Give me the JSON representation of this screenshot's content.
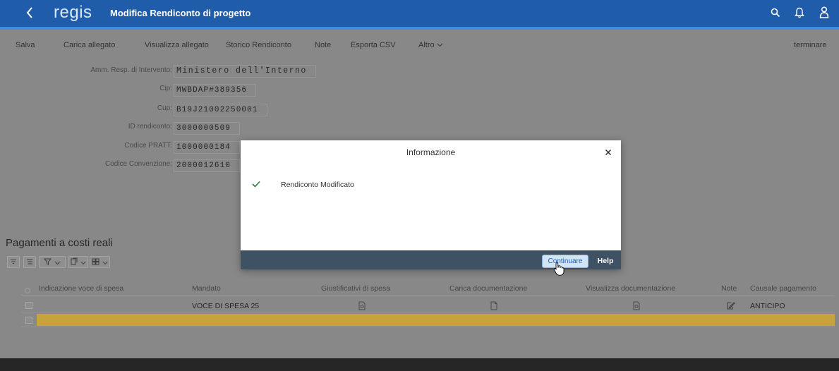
{
  "shell": {
    "logo": "regis",
    "title": "Modifica Rendiconto di progetto"
  },
  "toolbar": {
    "items": [
      "Salva",
      "Carica allegato",
      "Visualizza allegato",
      "Storico Rendiconto",
      "Note",
      "Esporta CSV"
    ],
    "more_label": "Altro",
    "exit_label": "terminare"
  },
  "form": {
    "fields": [
      {
        "label": "Amm. Resp. di Intervento:",
        "value": "Ministero dell'Interno"
      },
      {
        "label": "Cip:",
        "value": "MWBDAP#389356"
      },
      {
        "label": "Cup:",
        "value": "B19J21002250001"
      },
      {
        "label": "ID rendiconto:",
        "value": "3000000509"
      },
      {
        "label": "Codice PRATT:",
        "value": "1000000184"
      },
      {
        "label": "Codice Convenzione:",
        "value": "2000012610"
      }
    ]
  },
  "payments": {
    "title": "Pagamenti a costi reali",
    "columns": [
      "Indicazione voce di spesa",
      "Mandato",
      "Giustificativi di spesa",
      "Carica documentazione",
      "Visualizza documentazione",
      "Note",
      "Causale pagamento"
    ],
    "rows": [
      {
        "mandato": "VOCE DI SPESA 25",
        "causale": "ANTICIPO",
        "highlighted": false
      },
      {
        "mandato": "",
        "causale": "",
        "highlighted": true
      }
    ]
  },
  "dialog": {
    "title": "Informazione",
    "message": "Rendiconto Modificato",
    "continue_label": "Continuare",
    "help_label": "Help"
  },
  "icons": {
    "back": "chevron-left-icon",
    "search": "search-icon",
    "notifications": "bell-icon",
    "user": "user-icon",
    "more": "chevron-down-icon",
    "close": "close-icon",
    "success": "checkmark-icon",
    "cursor": "hand-cursor-icon"
  },
  "colors": {
    "shell": "#1f5ca9",
    "shell_stripe": "#3c8ee3",
    "row_highlight": "#c6a33b",
    "dialog_footer": "#3e5264",
    "success": "#2e7d32",
    "accent": "#1f5ea8",
    "page_background": "#8e8e8e"
  }
}
